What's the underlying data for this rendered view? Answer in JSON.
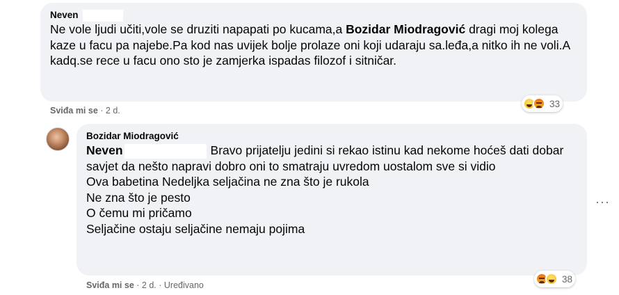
{
  "comment1": {
    "author": "Neven",
    "text_start": "Ne vole ljudi učiti,vole se druziti napapati po kucama,a ",
    "mention": "Bozidar Miodragović",
    "text_end": " dragi moj kolega kaze u facu pa najebe.Pa kod nas uvijek bolje prolaze oni koji udaraju sa.leđa,a nitko ih ne voli.A kadq.se rece u facu ono sto je zamjerka ispadas filozof i sitničar.",
    "like_label": "Sviđa mi se",
    "separator": " · ",
    "time": "2 d.",
    "reaction_count": "33"
  },
  "reply": {
    "author": "Bozidar Miodragović",
    "mention": "Neven",
    "text_first": "Bravo prijatelju jedini si rekao istinu kad nekome hoćeš dati dobar savjet da nešto napravi dobro oni to smatraju uvredom uostalom sve si vidio",
    "lines": [
      "Ova babetina Nedeljka seljačina ne zna što je rukola",
      "Ne zna što je pesto",
      "O čemu mi pričamo",
      "Seljačine ostaju seljačine nemaju pojima"
    ],
    "like_label": "Sviđa mi se",
    "separator": " · ",
    "time": "2 d.",
    "edited": "Uređivano",
    "reaction_count": "38"
  },
  "more_options": "···",
  "icons": {
    "reaction1": [
      "haha-icon",
      "angry-icon"
    ],
    "reaction2": [
      "angry-icon",
      "haha-icon"
    ],
    "avatar": "avatar"
  },
  "colors": {
    "bubble": "#f0f2f5",
    "meta": "#65676b",
    "text": "#050505"
  }
}
